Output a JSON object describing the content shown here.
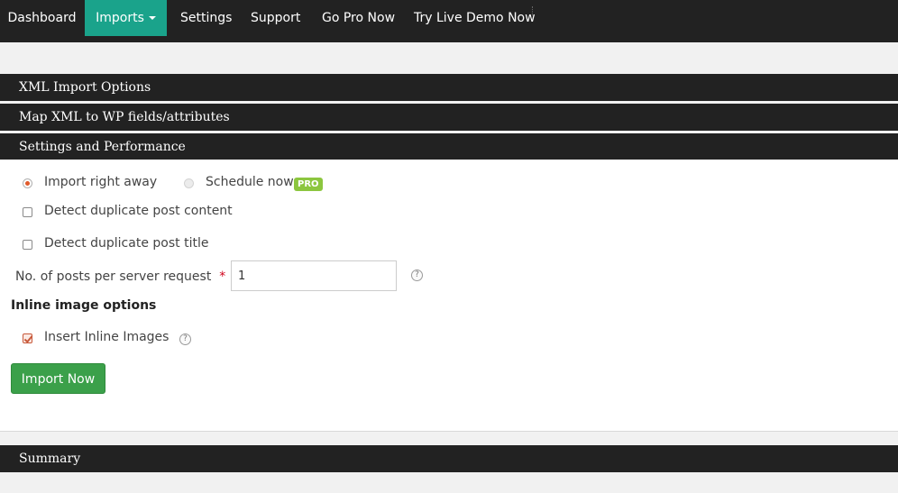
{
  "nav": {
    "items": [
      {
        "label": "Dashboard"
      },
      {
        "label": "Imports"
      },
      {
        "label": "Settings"
      },
      {
        "label": "Support"
      },
      {
        "label": "Go Pro Now"
      },
      {
        "label": "Try Live Demo Now"
      }
    ],
    "active_item": "Imports",
    "active_color": "#1aa38b"
  },
  "sections": {
    "xml_import_options": "XML Import Options",
    "map_fields": "Map XML to WP fields/attributes",
    "settings_performance": "Settings and Performance",
    "summary": "Summary"
  },
  "settings": {
    "import_mode": {
      "import_right_away_label": "Import right away",
      "schedule_now_label": "Schedule now",
      "pro_badge": "PRO",
      "selected": "Import right away"
    },
    "detect_duplicate_content_label": "Detect duplicate post content",
    "detect_duplicate_content_checked": false,
    "detect_duplicate_title_label": "Detect duplicate post title",
    "detect_duplicate_title_checked": false,
    "posts_per_request_label": "No. of posts per server request",
    "required_marker": "*",
    "posts_per_request_value": "1",
    "help_icon_glyph": "?",
    "inline_image_heading": "Inline image options",
    "insert_inline_images_label": "Insert Inline Images",
    "insert_inline_images_checked": true,
    "import_button": "Import Now"
  },
  "colors": {
    "nav_background": "#222222",
    "button_green": "#3ba04a",
    "pro_badge_green": "#8cc63f",
    "radio_accent": "#e05a2b"
  }
}
